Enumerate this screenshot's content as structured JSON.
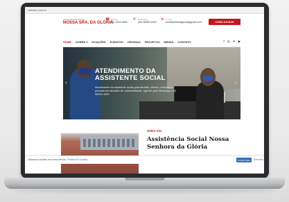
{
  "browser": {
    "url": "website.com.br"
  },
  "header": {
    "logo_top": "ASSISTÊNCIA SOCIAL",
    "logo_main": "NOSSA SRA. DA GLÓRIA",
    "phone_label": "Telefone",
    "phone_value": "(32) 3215-0465",
    "whatsapp_label": "WhatsApp",
    "whatsapp_value": "(32) 98999-4023",
    "email_label": "E-mail",
    "email_value": "ambdadolardagloria@gmail.com",
    "donate_label": "COMO AJUDAR"
  },
  "nav": {
    "items": [
      "HOME",
      "SOBRE ▾",
      "DOAÇÕES",
      "EVENTOS",
      "OFICINAS",
      "PROJETOS",
      "MÍDIAS",
      "CONTATO"
    ],
    "social_icons": [
      "facebook-icon",
      "instagram-icon",
      "twitter-icon",
      "youtube-icon"
    ]
  },
  "hero": {
    "title": "ATENDIMENTO DA ASSISTENTE SOCIAL",
    "text": "Atendimento da assistente social para famílias, idosos, mulheres e pessoas em situação de vulnerabilidade. Agende pelo WhatsApp (32) 98999-4023.",
    "prev_arrow": "‹",
    "next_arrow": "›"
  },
  "about": {
    "kicker": "Sobre nós",
    "title": "Assistência Social Nossa Senhora da Glória"
  },
  "cookie": {
    "text": "Utilizamos cookies em nosso serviço.",
    "link": "Política de Cookies",
    "accept": "Aceitar todos",
    "reject": "Gerenciar"
  },
  "colors": {
    "accent": "#c4161c",
    "cookie_button": "#3d6fb5"
  }
}
